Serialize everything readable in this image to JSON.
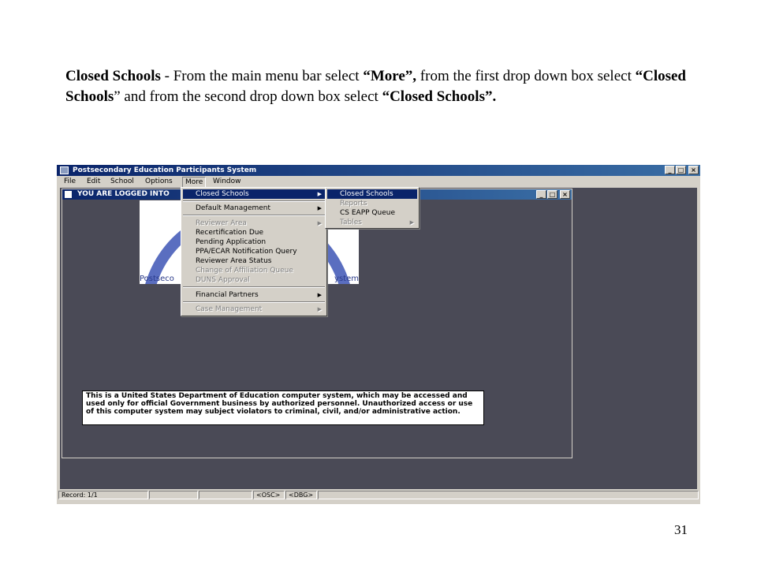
{
  "instructions": {
    "bold1": "Closed Schools",
    "text1": " - From the main menu bar select ",
    "bold2": "“More”,",
    "text2": " from the first drop down box select ",
    "bold3": "“Closed Schools",
    "text3": "” and from the second drop down box select ",
    "bold4": "“Closed Schools”."
  },
  "app": {
    "title": "Postsecondary Education Participants System",
    "menubar": [
      "File",
      "Edit",
      "School",
      "Options",
      "More",
      "Window"
    ],
    "child_title": "YOU ARE LOGGED INTO",
    "logo_left": "Postseco",
    "logo_right": "ystem",
    "window_buttons": {
      "minimize": "_",
      "maximize": "□",
      "close": "×"
    },
    "warning": "This is a United States Department of Education computer system, which may be accessed and used only for official Government business by authorized personnel. Unauthorized access or use of this computer system may subject violators to criminal, civil, and/or administrative action.",
    "status": {
      "record": "Record: 1/1",
      "osc": "<OSC>",
      "dbg": "<DBG>"
    }
  },
  "more_menu": [
    {
      "label": "Closed Schools",
      "submenu": true,
      "selected": true,
      "disabled": false
    },
    {
      "label": "Default Management",
      "submenu": true,
      "selected": false,
      "disabled": false
    },
    {
      "label": "Reviewer Area",
      "submenu": true,
      "selected": false,
      "disabled": true
    },
    {
      "label": "Recertification Due",
      "submenu": false,
      "selected": false,
      "disabled": false
    },
    {
      "label": "Pending Application",
      "submenu": false,
      "selected": false,
      "disabled": false
    },
    {
      "label": "PPA/ECAR Notification Query",
      "submenu": false,
      "selected": false,
      "disabled": false
    },
    {
      "label": "Reviewer Area Status",
      "submenu": false,
      "selected": false,
      "disabled": false
    },
    {
      "label": "Change of Affiliation Queue",
      "submenu": false,
      "selected": false,
      "disabled": true
    },
    {
      "label": "DUNS Approval",
      "submenu": false,
      "selected": false,
      "disabled": true
    },
    {
      "label": "Financial Partners",
      "submenu": true,
      "selected": false,
      "disabled": false
    },
    {
      "label": "Case Management",
      "submenu": true,
      "selected": false,
      "disabled": true
    }
  ],
  "closed_schools_menu": [
    {
      "label": "Closed Schools",
      "submenu": false,
      "selected": true,
      "disabled": false
    },
    {
      "label": "Reports",
      "submenu": false,
      "selected": false,
      "disabled": true
    },
    {
      "label": "CS EAPP Queue",
      "submenu": false,
      "selected": false,
      "disabled": false
    },
    {
      "label": "Tables",
      "submenu": true,
      "selected": false,
      "disabled": true
    }
  ],
  "slide_number": "31"
}
